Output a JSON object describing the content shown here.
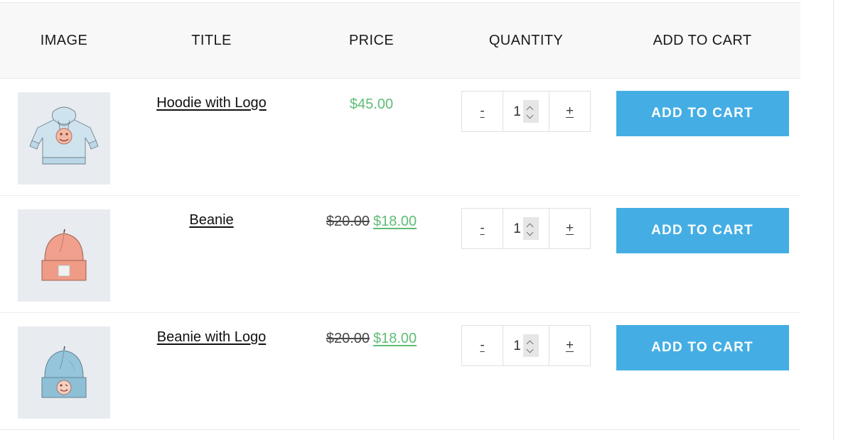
{
  "table": {
    "columns": [
      {
        "key": "image",
        "label": "IMAGE"
      },
      {
        "key": "title",
        "label": "TITLE"
      },
      {
        "key": "price",
        "label": "PRICE"
      },
      {
        "key": "quantity",
        "label": "QUANTITY"
      },
      {
        "key": "cart",
        "label": "ADD TO CART"
      }
    ],
    "rows": [
      {
        "image_alt": "hoodie-with-logo-thumbnail",
        "title": "Hoodie with Logo",
        "price": {
          "on_sale": false,
          "regular": "$45.00",
          "sale": ""
        },
        "quantity": {
          "value": "1",
          "decrement_label": "-",
          "increment_label": "+"
        },
        "cart_label": "ADD TO CART"
      },
      {
        "image_alt": "beanie-thumbnail",
        "title": "Beanie",
        "price": {
          "on_sale": true,
          "regular": "$20.00",
          "sale": "$18.00"
        },
        "quantity": {
          "value": "1",
          "decrement_label": "-",
          "increment_label": "+"
        },
        "cart_label": "ADD TO CART"
      },
      {
        "image_alt": "beanie-with-logo-thumbnail",
        "title": "Beanie with Logo",
        "price": {
          "on_sale": true,
          "regular": "$20.00",
          "sale": "$18.00"
        },
        "quantity": {
          "value": "1",
          "decrement_label": "-",
          "increment_label": "+"
        },
        "cart_label": "ADD TO CART"
      }
    ]
  },
  "colors": {
    "accent_button": "#44aee4",
    "price_green": "#5fbd75",
    "header_background": "#f8f8f8",
    "thumb_background": "#e8ebef",
    "row_border": "#ededed"
  }
}
